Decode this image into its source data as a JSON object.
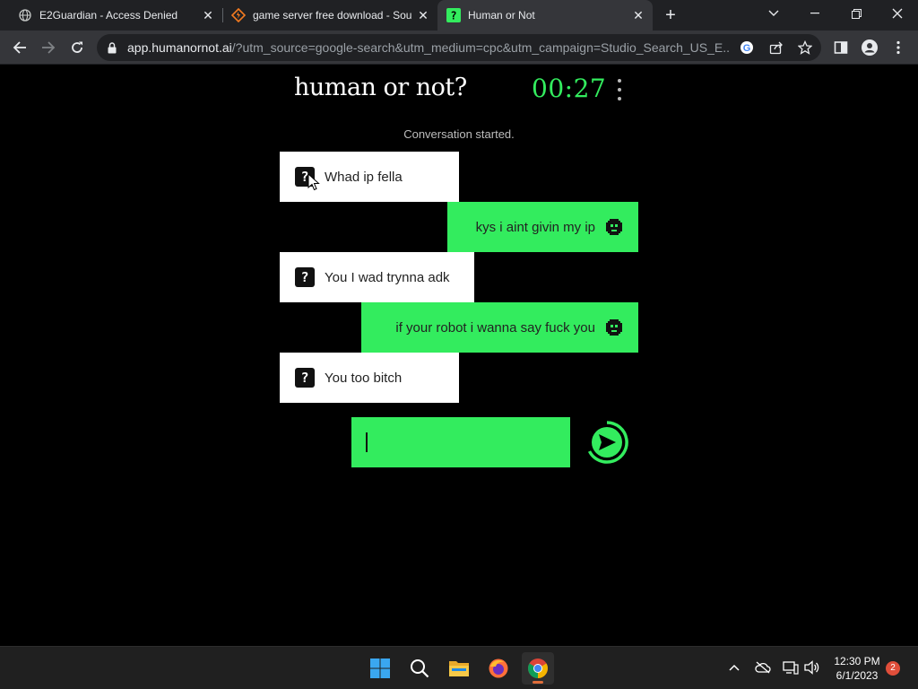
{
  "browser": {
    "tabs": [
      {
        "title": "E2Guardian - Access Denied",
        "favicon": "globe-icon",
        "active": false
      },
      {
        "title": "game server free download - Sou",
        "favicon": "sourceforge-icon",
        "active": false
      },
      {
        "title": "Human or Not",
        "favicon": "humanornot-icon",
        "active": true
      }
    ],
    "address": {
      "host": "app.humanornot.ai",
      "path": "/?utm_source=google-search&utm_medium=cpc&utm_campaign=Studio_Search_US_E..."
    }
  },
  "app": {
    "logo": "human or not?",
    "timer": "00:27",
    "status": "Conversation started.",
    "messages": [
      {
        "sender": "them",
        "text": "Whad ip fella"
      },
      {
        "sender": "me",
        "text": "kys i aint givin my ip"
      },
      {
        "sender": "them",
        "text": "You I wad trynna adk"
      },
      {
        "sender": "me",
        "text": "if your robot i wanna say fuck you"
      },
      {
        "sender": "them",
        "text": "You too bitch"
      }
    ],
    "input": {
      "value": "",
      "placeholder": ""
    },
    "colors": {
      "accent": "#33ec5e",
      "background": "#000000",
      "bubble_them": "#ffffff"
    }
  },
  "taskbar": {
    "apps": [
      "windows-start-icon",
      "search-icon",
      "file-explorer-icon",
      "firefox-icon",
      "chrome-icon"
    ],
    "time": "12:30 PM",
    "date": "6/1/2023",
    "notification_count": "2"
  }
}
